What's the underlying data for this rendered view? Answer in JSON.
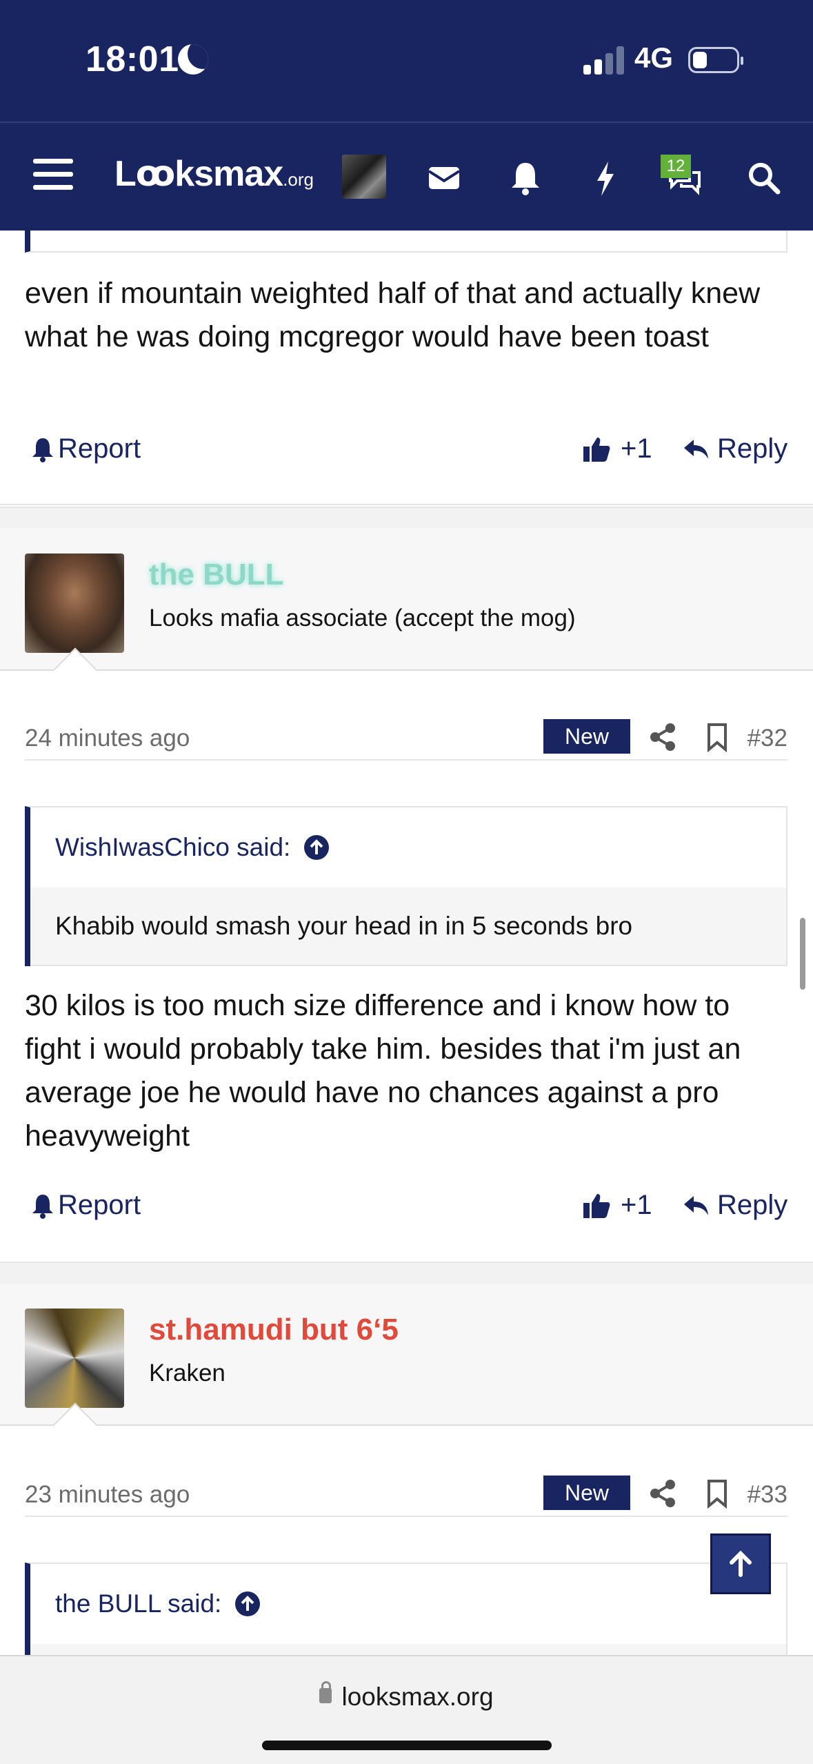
{
  "status_bar": {
    "time": "18:01",
    "network": "4G",
    "icons": [
      "moon-icon",
      "signal-icon",
      "battery-icon"
    ]
  },
  "nav": {
    "logo": "Lꝏksmax",
    "logo_domain": ".org",
    "alerts_badge": "12",
    "icons": [
      "menu-icon",
      "avatar",
      "mail-icon",
      "bell-icon",
      "bolt-icon",
      "chat-icon",
      "search-icon"
    ]
  },
  "posts": [
    {
      "body": "even if mountain weighted half of that and actually knew what he was doing mcgregor would have been toast",
      "report_label": "Report",
      "like_count": "+1",
      "reply_label": "Reply"
    },
    {
      "username": "the BULL",
      "username_color": "#8fd8c7",
      "user_title": "Looks mafia associate (accept the mog)",
      "time": "24 minutes ago",
      "new_label": "New",
      "post_number": "#32",
      "quote_author": "WishIwasChico said:",
      "quote_text": "Khabib would smash your head in in 5 seconds bro",
      "body": "30 kilos is too much size difference and i know how to fight i would probably take him. besides that i'm just an average joe he would have no chances against a pro heavyweight",
      "report_label": "Report",
      "like_count": "+1",
      "reply_label": "Reply"
    },
    {
      "username": "st.hamudi but 6‘5",
      "username_color": "#e04a3a",
      "user_title": "Kraken",
      "time": "23 minutes ago",
      "new_label": "New",
      "post_number": "#33",
      "quote_author": "the BULL said:"
    }
  ],
  "browser": {
    "url": "looksmax.org"
  },
  "colors": {
    "brand": "#182560",
    "badge_green": "#63b03b"
  }
}
